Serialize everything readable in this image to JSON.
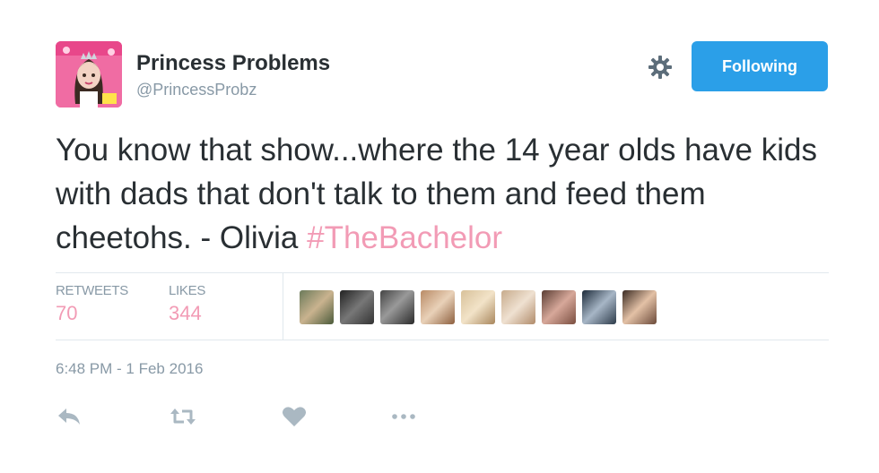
{
  "user": {
    "display_name": "Princess Problems",
    "handle": "@PrincessProbz"
  },
  "header": {
    "follow_label": "Following",
    "gear_icon": "gear-icon"
  },
  "tweet": {
    "text": "You know that show...where the 14 year olds have kids with dads that don't talk to them and feed them cheetohs. - Olivia ",
    "hashtag": "#TheBachelor",
    "timestamp": "6:48 PM - 1 Feb 2016"
  },
  "stats": {
    "retweets_label": "RETWEETS",
    "retweets_value": "70",
    "likes_label": "LIKES",
    "likes_value": "344"
  },
  "likers_count_shown": 9,
  "colors": {
    "accent": "#2b9fe8",
    "pink": "#f29bb5",
    "muted": "#8899a6",
    "text": "#292f33"
  },
  "actions": [
    "reply-icon",
    "retweet-icon",
    "heart-icon",
    "more-icon"
  ]
}
